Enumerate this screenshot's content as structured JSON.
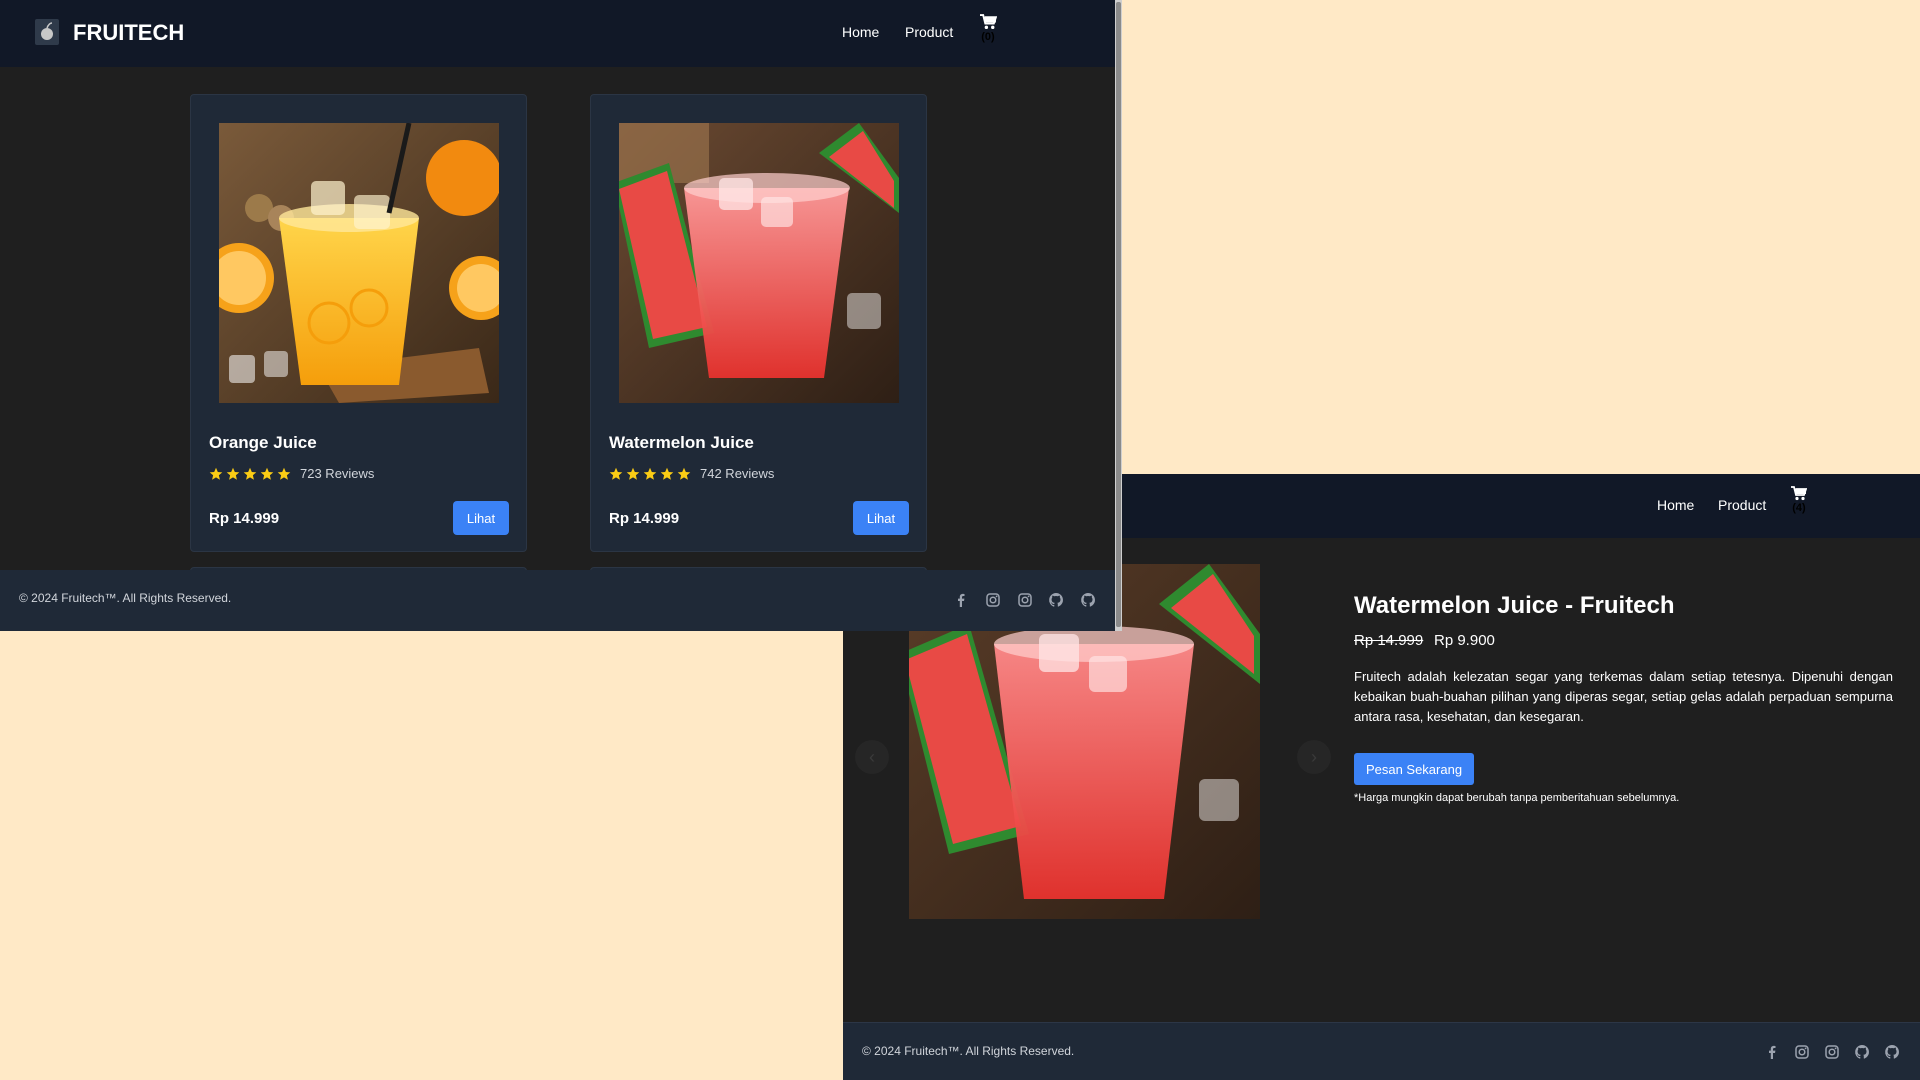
{
  "list_window": {
    "brand": "FRUITECH",
    "nav": {
      "home": "Home",
      "product": "Product",
      "cart_count": "(0)"
    },
    "products": [
      {
        "name": "Orange Juice",
        "rating": 5,
        "reviews": "723 Reviews",
        "price": "Rp 14.999",
        "button": "Lihat",
        "image": "orange-juice-photo"
      },
      {
        "name": "Watermelon Juice",
        "rating": 5,
        "reviews": "742 Reviews",
        "price": "Rp 14.999",
        "button": "Lihat",
        "image": "watermelon-juice-photo"
      }
    ],
    "footer": {
      "copyright": "© 2024 Fruitech™. All Rights Reserved.",
      "socials": [
        "facebook-icon",
        "instagram-icon",
        "instagram-icon",
        "github-icon",
        "github-icon"
      ]
    }
  },
  "detail_window": {
    "nav": {
      "home": "Home",
      "product": "Product",
      "cart_count": "(4)"
    },
    "title": "Watermelon Juice - Fruitech",
    "price_old": "Rp 14.999",
    "price_new": "Rp 9.900",
    "description": "Fruitech adalah kelezatan segar yang terkemas dalam setiap tetesnya. Dipenuhi dengan kebaikan buah-buahan pilihan yang diperas segar, setiap gelas adalah perpaduan sempurna antara rasa, kesehatan, dan kesegaran.",
    "order_button": "Pesan Sekarang",
    "note": "*Harga mungkin dapat berubah tanpa pemberitahuan sebelumnya.",
    "carousel": {
      "prev": "‹",
      "next": "›"
    },
    "footer": {
      "copyright": "© 2024 Fruitech™. All Rights Reserved.",
      "socials": [
        "facebook-icon",
        "instagram-icon",
        "instagram-icon",
        "github-icon",
        "github-icon"
      ]
    }
  },
  "colors": {
    "desktop_bg": "#ffe9c6",
    "navbar": "#111827",
    "page_bg": "#1f1f1f",
    "card_bg": "#1f2937",
    "accent_button": "#3b82f6",
    "star": "#facc15"
  }
}
